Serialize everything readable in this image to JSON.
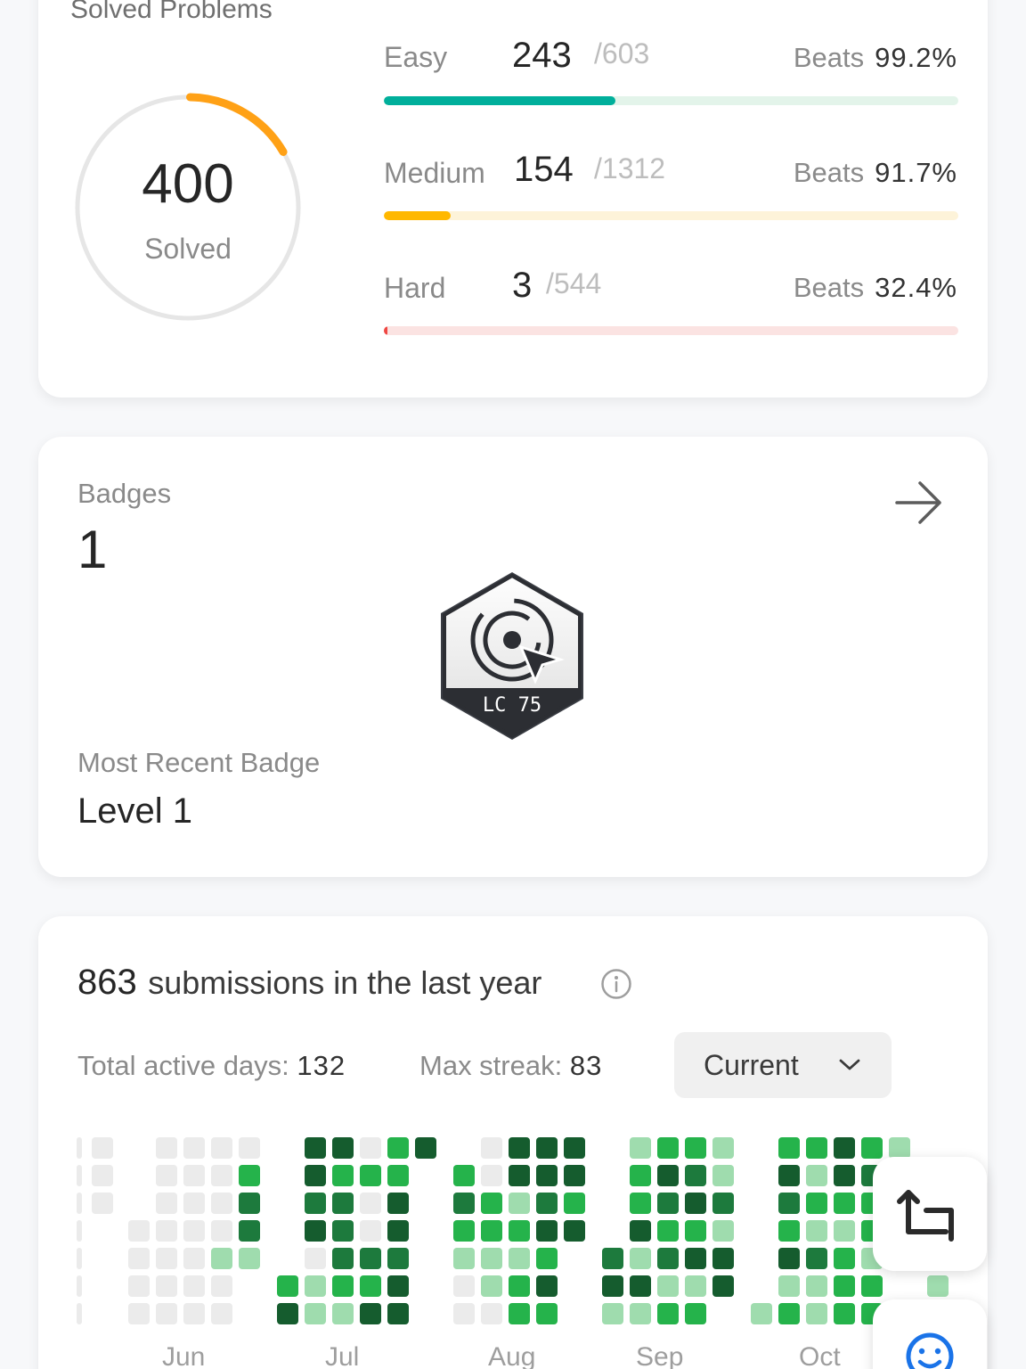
{
  "solved": {
    "title": "Solved Problems",
    "total": "400",
    "total_label": "Solved",
    "ring_color": "#ffa116",
    "rows": [
      {
        "label": "Easy",
        "solved": "243",
        "total": "/603",
        "beats_label": "Beats",
        "beats": "99.2%",
        "progress": 0.403,
        "color": "#00af9b",
        "track": "#e3f4ea"
      },
      {
        "label": "Medium",
        "solved": "154",
        "total": "/1312",
        "beats_label": "Beats",
        "beats": "91.7%",
        "progress": 0.117,
        "color": "#ffb800",
        "track": "#fdf3d9"
      },
      {
        "label": "Hard",
        "solved": "3",
        "total": "/544",
        "beats_label": "Beats",
        "beats": "32.4%",
        "progress": 0.006,
        "color": "#ef4743",
        "track": "#fbe3e2"
      }
    ]
  },
  "badges": {
    "title": "Badges",
    "count": "1",
    "badge_text": "LC 75",
    "recent_label": "Most Recent Badge",
    "recent_value": "Level 1"
  },
  "submissions": {
    "count": "863",
    "label": "submissions in the last year",
    "active_days_label": "Total active days:",
    "active_days": "132",
    "max_streak_label": "Max streak:",
    "max_streak": "83",
    "period": "Current",
    "months": [
      "Jun",
      "Jul",
      "Aug",
      "Sep",
      "Oct"
    ],
    "colors": [
      "#ebebeb",
      "#9fdcae",
      "#25b34b",
      "#1d7a3d",
      "#155c2e"
    ]
  }
}
